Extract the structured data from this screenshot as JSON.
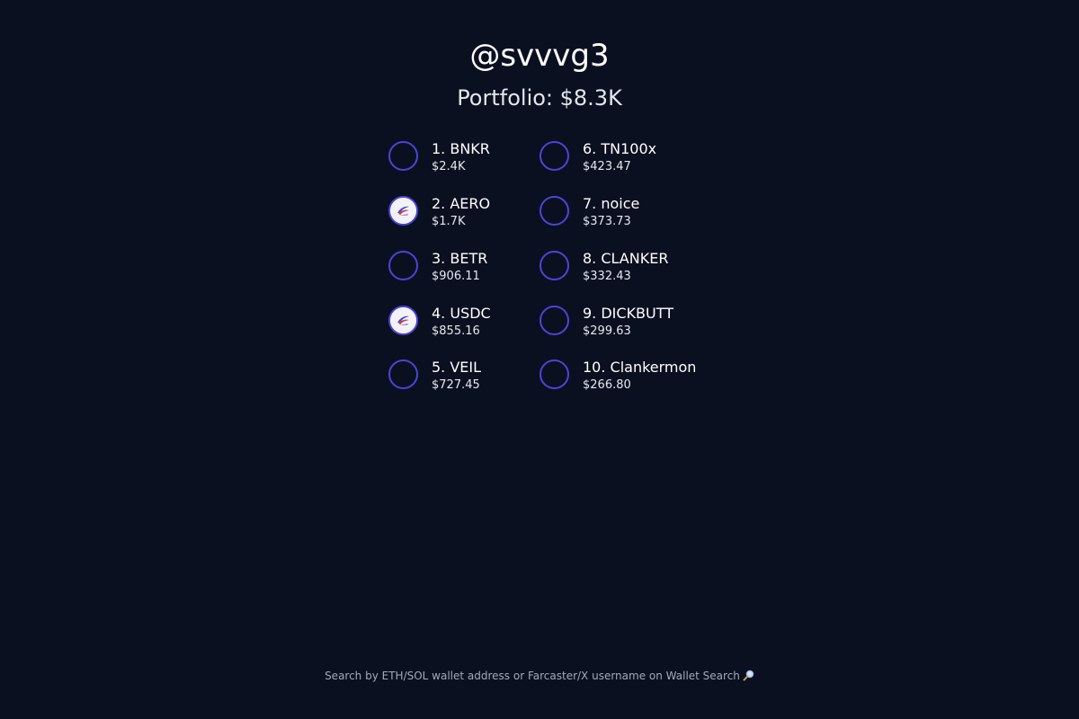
{
  "profile": {
    "username": "@svvvg3",
    "portfolio_label": "Portfolio: $8.3K"
  },
  "colors": {
    "background": "#0b1020",
    "ring": "#4c44d9",
    "text_primary": "#ffffff",
    "text_muted": "#a4a8b6"
  },
  "holdings": [
    {
      "rank_name": "1. BNKR",
      "value": "$2.4K",
      "has_logo": false
    },
    {
      "rank_name": "2. AERO",
      "value": "$1.7K",
      "has_logo": true
    },
    {
      "rank_name": "3. BETR",
      "value": "$906.11",
      "has_logo": false
    },
    {
      "rank_name": "4. USDC",
      "value": "$855.16",
      "has_logo": true
    },
    {
      "rank_name": "5. VEIL",
      "value": "$727.45",
      "has_logo": false
    },
    {
      "rank_name": "6. TN100x",
      "value": "$423.47",
      "has_logo": false
    },
    {
      "rank_name": "7. noice",
      "value": "$373.73",
      "has_logo": false
    },
    {
      "rank_name": "8. CLANKER",
      "value": "$332.43",
      "has_logo": false
    },
    {
      "rank_name": "9. DICKBUTT",
      "value": "$299.63",
      "has_logo": false
    },
    {
      "rank_name": "10. Clankermon",
      "value": "$266.80",
      "has_logo": false
    }
  ],
  "footer": {
    "text": "Search by ETH/SOL wallet address or Farcaster/X username on Wallet Search",
    "icon": "magnifier-icon"
  }
}
